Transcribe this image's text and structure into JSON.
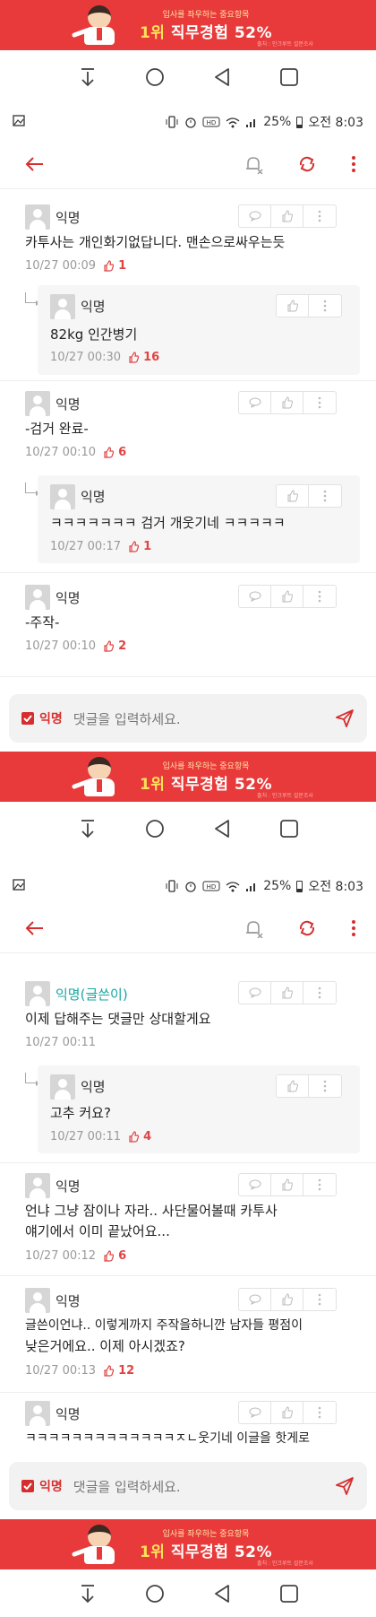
{
  "ad": {
    "subtitle": "입사를 좌우하는 중요항목",
    "rank": "1위",
    "headline": "직무경험 52%",
    "source": "출처 : 인크루트 설문조사"
  },
  "status": {
    "battery": "25%",
    "time": "오전 8:03"
  },
  "colors": {
    "accent": "#d62e2e",
    "writer": "#19a6a0",
    "ad": "#e83a3a"
  },
  "input": {
    "anon_label": "익명",
    "placeholder": "댓글을 입력하세요."
  },
  "screen1": {
    "comments": [
      {
        "author": "익명",
        "body": "카투사는 개인화기없답니다. 맨손으로싸우는듯",
        "time": "10/27 00:09",
        "likes": "1"
      },
      {
        "author": "익명",
        "body": "82kg 인간병기",
        "time": "10/27 00:30",
        "likes": "16"
      },
      {
        "author": "익명",
        "body": "-검거 완료-",
        "time": "10/27 00:10",
        "likes": "6"
      },
      {
        "author": "익명",
        "body": "ㅋㅋㅋㅋㅋㅋㅋ 검거 개웃기네 ㅋㅋㅋㅋㅋ",
        "time": "10/27 00:17",
        "likes": "1"
      },
      {
        "author": "익명",
        "body": "-주작-",
        "time": "10/27 00:10",
        "likes": "2"
      }
    ]
  },
  "screen2": {
    "comments": [
      {
        "author": "익명(글쓴이)",
        "body": "이제 답해주는 댓글만 상대할게요",
        "time": "10/27 00:11",
        "likes": ""
      },
      {
        "author": "익명",
        "body": "고추 커요?",
        "time": "10/27 00:11",
        "likes": "4"
      },
      {
        "author": "익명",
        "body_1": "언냐 그냥 잠이나 자라.. 사단물어볼때 카투사",
        "body_2": "얘기에서 이미 끝났어요...",
        "time": "10/27 00:12",
        "likes": "6"
      },
      {
        "author": "익명",
        "body_1": "글쓴이언냐.. 이렇게까지 주작을하니깐 남자들 평점이",
        "body_2": "낮은거에요.. 이제 아시겠죠?",
        "time": "10/27 00:13",
        "likes": "12"
      },
      {
        "author": "익명",
        "body": "ㅋㅋㅋㅋㅋㅋㅋㅋㅋㅋㅋㅋㅋㅈㄴ웃기네 이글을 핫게로"
      }
    ]
  }
}
